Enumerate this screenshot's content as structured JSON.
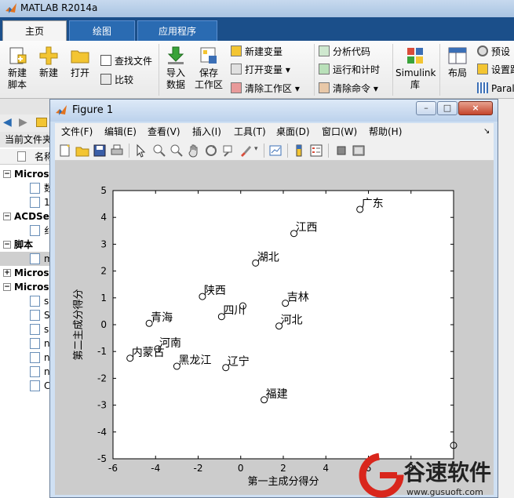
{
  "app": {
    "title": "MATLAB R2014a",
    "tabs": [
      {
        "label": "主页"
      },
      {
        "label": "绘图"
      },
      {
        "label": "应用程序"
      }
    ]
  },
  "ribbon": {
    "new_script": "新建\n脚本",
    "new": "新建",
    "open": "打开",
    "find_files": "查找文件",
    "compare": "比较",
    "import_data": "导入\n数据",
    "save_workspace": "保存\n工作区",
    "new_variable": "新建变量",
    "open_variable": "打开变量",
    "clear_workspace": "清除工作区",
    "analyze_code": "分析代码",
    "run_and_time": "运行和计时",
    "clear_commands": "清除命令",
    "simulink": "Simulink\n库",
    "layout": "布局",
    "preferences": "预设",
    "set_path": "设置路",
    "parallel": "Paral"
  },
  "left_panel": {
    "header": "当前文件夹",
    "name_col": "名称",
    "rows": [
      {
        "label": "Microso",
        "kind": "group"
      },
      {
        "label": "数",
        "kind": "file"
      },
      {
        "label": "1",
        "kind": "file"
      },
      {
        "label": "ACDSee",
        "kind": "group"
      },
      {
        "label": "纟",
        "kind": "file"
      },
      {
        "label": "脚本",
        "kind": "group"
      },
      {
        "label": "m",
        "kind": "file-selected"
      },
      {
        "label": "Microso",
        "kind": "group-collapsed"
      },
      {
        "label": "Microso",
        "kind": "group"
      },
      {
        "label": "s",
        "kind": "file"
      },
      {
        "label": "S",
        "kind": "file"
      },
      {
        "label": "s",
        "kind": "file"
      },
      {
        "label": "n",
        "kind": "file"
      },
      {
        "label": "n",
        "kind": "file"
      },
      {
        "label": "n",
        "kind": "file"
      },
      {
        "label": "C",
        "kind": "file"
      }
    ]
  },
  "figure": {
    "title": "Figure 1",
    "menu": [
      "文件(F)",
      "编辑(E)",
      "查看(V)",
      "插入(I)",
      "工具(T)",
      "桌面(D)",
      "窗口(W)",
      "帮助(H)"
    ],
    "window_buttons": {
      "minimize": "–",
      "restore": "□",
      "close": "×"
    }
  },
  "chart_data": {
    "type": "scatter",
    "title": "",
    "xlabel": "第一主成分得分",
    "ylabel": "第二主成分得分",
    "xlim": [
      -6,
      10
    ],
    "ylim": [
      -5,
      5
    ],
    "xticks": [
      -6,
      -4,
      -2,
      0,
      2,
      4,
      6,
      8
    ],
    "yticks": [
      -5,
      -4,
      -3,
      -2,
      -1,
      0,
      1,
      2,
      3,
      4,
      5
    ],
    "marker": "circle-open",
    "points": [
      {
        "label": "广东",
        "x": 5.6,
        "y": 4.3
      },
      {
        "label": "江西",
        "x": 2.5,
        "y": 3.4
      },
      {
        "label": "湖北",
        "x": 0.7,
        "y": 2.3
      },
      {
        "label": "陕西",
        "x": -1.8,
        "y": 1.05
      },
      {
        "label": "吉林",
        "x": 2.1,
        "y": 0.8
      },
      {
        "label": "四川",
        "x": -0.9,
        "y": 0.3
      },
      {
        "label": "",
        "x": 0.1,
        "y": 0.7
      },
      {
        "label": "河北",
        "x": 1.8,
        "y": -0.05
      },
      {
        "label": "青海",
        "x": -4.3,
        "y": 0.05
      },
      {
        "label": "河南",
        "x": -3.9,
        "y": -0.9
      },
      {
        "label": "内蒙古",
        "x": -5.2,
        "y": -1.25
      },
      {
        "label": "黑龙江",
        "x": -3.0,
        "y": -1.55
      },
      {
        "label": "辽宁",
        "x": -0.7,
        "y": -1.6
      },
      {
        "label": "福建",
        "x": 1.1,
        "y": -2.8
      },
      {
        "label": "",
        "x": 10.0,
        "y": -4.5
      }
    ]
  },
  "watermark": {
    "brand": "谷速软件",
    "url": "www.gusuoft.com",
    "color_red": "#d9261c"
  }
}
